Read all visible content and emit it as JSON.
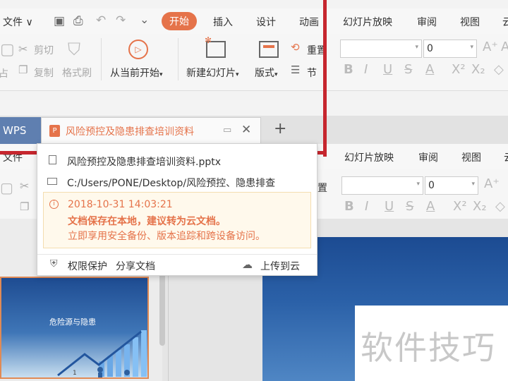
{
  "menu": {
    "file": "文件",
    "items": [
      "开始",
      "插入",
      "设计",
      "动画",
      "幻灯片放映",
      "审阅",
      "视图",
      "云"
    ]
  },
  "ribbon": {
    "cut": "剪切",
    "copy": "复制",
    "format_painter": "格式刷",
    "paste_partial": "占",
    "play_from_current": "从当前开始",
    "new_slide": "新建幻灯片",
    "layout": "版式",
    "reset": "重置",
    "section": "节",
    "font_size": "0"
  },
  "tabs": {
    "wps": "WPS",
    "doc": "风险预控及隐患排查培训资料",
    "add": "+"
  },
  "menu2": {
    "file": "文件",
    "items": [
      "幻灯片放映",
      "审阅",
      "视图",
      "云"
    ]
  },
  "ribbon2": {
    "font_size": "0",
    "reset_partial": "置"
  },
  "popup": {
    "filename": "风险预控及隐患排查培训资料.pptx",
    "path": "C:/Users/PONE/Desktop/风险预控、隐患排查",
    "time": "2018-10-31 14:03:21",
    "warning": "文档保存在本地，建议转为云文档。",
    "benefit": "立即享用安全备份、版本追踪和跨设备访问。",
    "protect": "权限保护",
    "share": "分享文档",
    "upload": "上传到云"
  },
  "slide": {
    "title": "危险源与隐患",
    "page_num_partial": "1"
  },
  "watermark": "软件技巧",
  "colors": {
    "accent": "#e5734a",
    "wps_tab": "#5f7fb0",
    "red_frame": "#c6262e",
    "warn_text": "#e5734a"
  }
}
